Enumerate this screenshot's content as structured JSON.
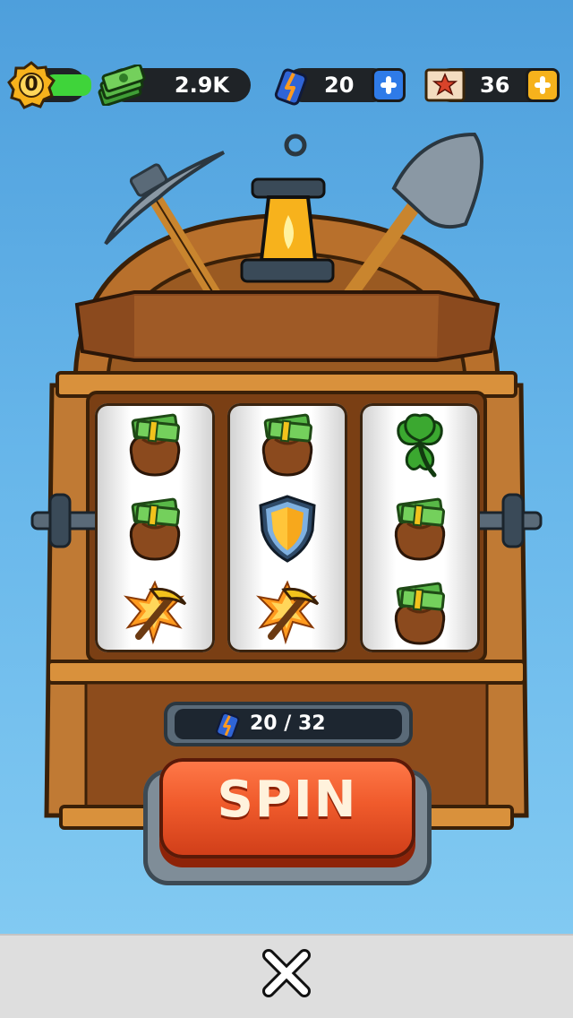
{
  "top_bar": {
    "level": "0",
    "cash": "2.9K",
    "spins": "20",
    "tickets": "36",
    "icons": [
      "level-badge-icon",
      "cash-stack-icon",
      "spin-ticket-icon",
      "add-spins-icon",
      "star-ticket-icon",
      "add-tickets-icon"
    ]
  },
  "slot_machine": {
    "reels": [
      [
        "money-bag",
        "money-bag",
        "pickaxe"
      ],
      [
        "money-bag",
        "shield",
        "pickaxe"
      ],
      [
        "clover",
        "money-bag",
        "money-bag"
      ]
    ],
    "spin_counter": "20 / 32",
    "spin_button_label": "SPIN"
  },
  "bottom_bar": {
    "close_icon": "close-icon"
  },
  "colors": {
    "sky": "#67b6ea",
    "wood": "#b8702c",
    "spin_button": "#f05b2c",
    "plus_blue": "#2f7be8",
    "plus_yellow": "#f6b21c"
  }
}
